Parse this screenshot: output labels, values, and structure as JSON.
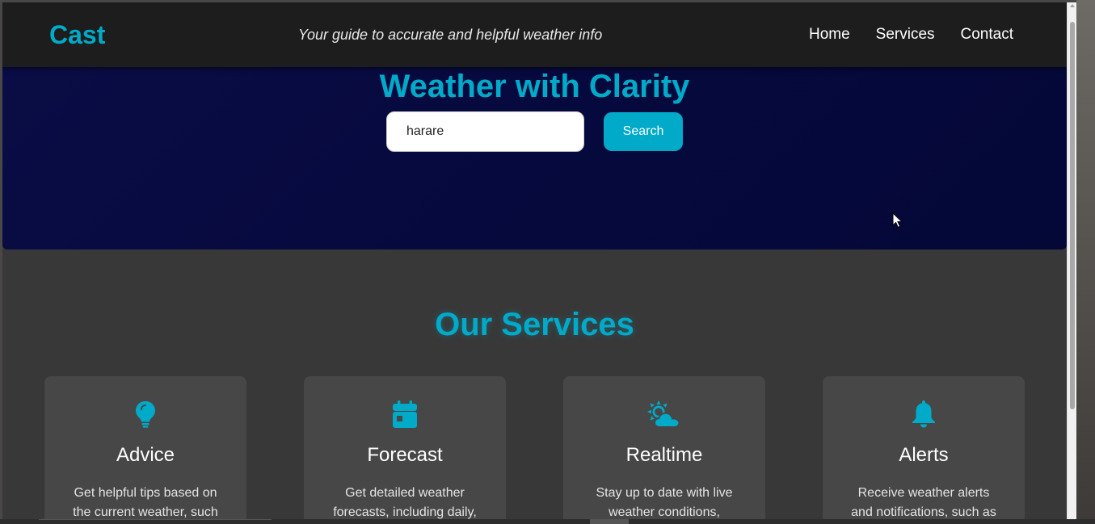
{
  "header": {
    "logo": "Cast",
    "tagline": "Your guide to accurate and helpful weather info",
    "nav": [
      "Home",
      "Services",
      "Contact"
    ]
  },
  "hero": {
    "title": "Weather with Clarity",
    "search_value": "harare",
    "search_button": "Search"
  },
  "services": {
    "title": "Our Services",
    "cards": [
      {
        "icon": "lightbulb-icon",
        "title": "Advice",
        "text": "Get helpful tips based on the current weather, such"
      },
      {
        "icon": "calendar-icon",
        "title": "Forecast",
        "text": "Get detailed weather forecasts, including daily,"
      },
      {
        "icon": "sun-cloud-icon",
        "title": "Realtime",
        "text": "Stay up to date with live weather conditions,"
      },
      {
        "icon": "bell-icon",
        "title": "Alerts",
        "text": "Receive weather alerts and notifications, such as"
      }
    ]
  },
  "colors": {
    "accent": "#00aac8",
    "header_bg": "#1d1d1d",
    "hero_bg": "#06093d",
    "body_bg": "#383838",
    "card_bg": "#474747"
  }
}
